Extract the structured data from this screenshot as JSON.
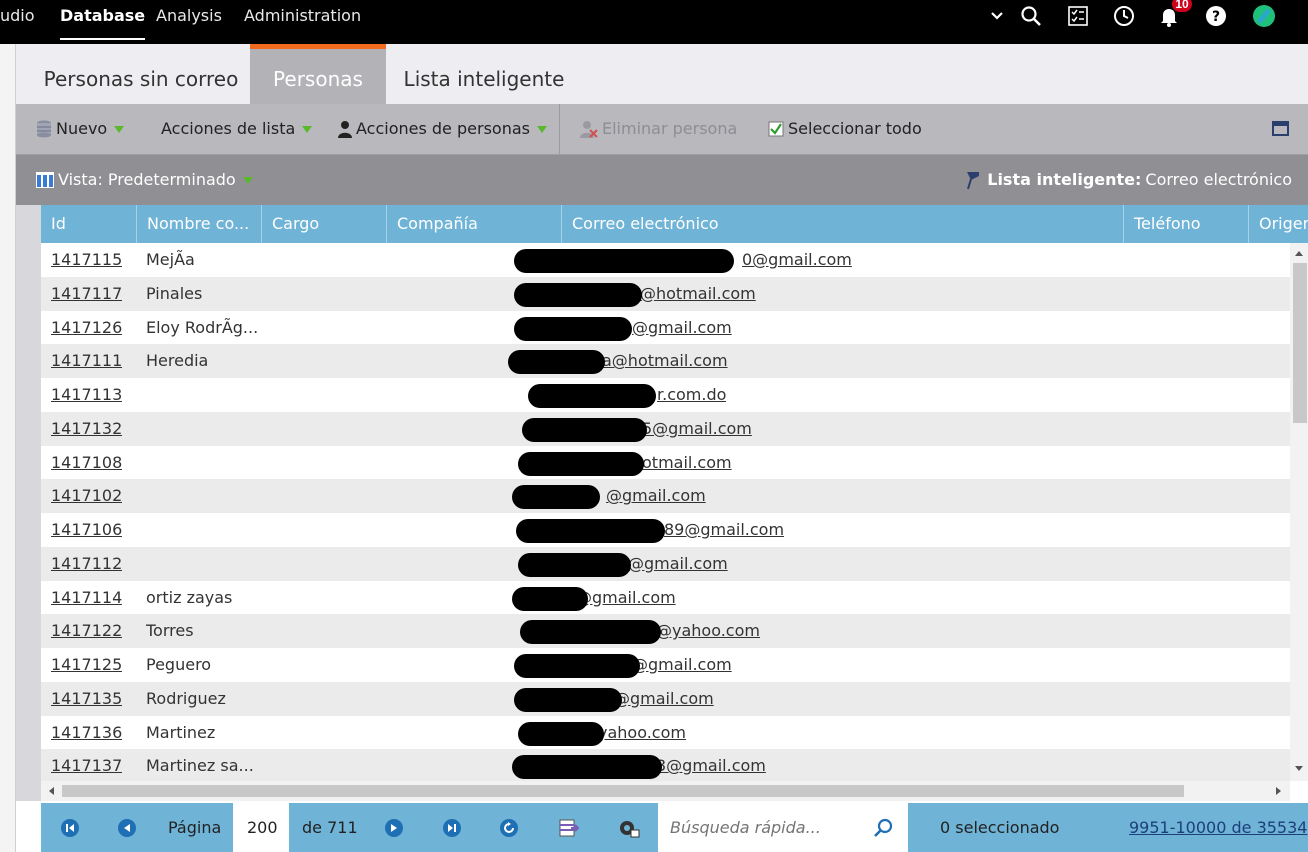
{
  "topbar": {
    "nav": [
      "udio",
      "Database",
      "Analysis",
      "Administration"
    ],
    "active_nav": "Database",
    "notification_count": "10",
    "icons": [
      "chevron-down-icon",
      "search-icon",
      "checklist-icon",
      "clock-icon",
      "bell-icon",
      "help-icon",
      "avatar-icon"
    ]
  },
  "tabs": [
    {
      "label": "Personas sin correo",
      "active": false
    },
    {
      "label": "Personas",
      "active": true
    },
    {
      "label": "Lista inteligente",
      "active": false
    }
  ],
  "toolbar": {
    "nuevo": "Nuevo",
    "acciones_lista": "Acciones de lista",
    "acciones_personas": "Acciones de personas",
    "eliminar": "Eliminar persona",
    "seleccionar": "Seleccionar todo"
  },
  "viewbar": {
    "view": "Vista: Predeterminado",
    "smartlist_label": "Lista inteligente:",
    "smartlist_value": "Correo electrónico"
  },
  "columns": [
    "Id",
    "Nombre co...",
    "Cargo",
    "Compañía",
    "Correo electrónico",
    "Teléfono",
    "Origen"
  ],
  "rows": [
    {
      "id": "1417115",
      "name": "MejÃa",
      "email": "0@gmail.com"
    },
    {
      "id": "1417117",
      "name": "Pinales",
      "email": "@hotmail.com"
    },
    {
      "id": "1417126",
      "name": "Eloy RodrÃg...",
      "email": "@gmail.com"
    },
    {
      "id": "1417111",
      "name": "Heredia",
      "email": "a@hotmail.com"
    },
    {
      "id": "1417113",
      "name": "",
      "email": "r.com.do"
    },
    {
      "id": "1417132",
      "name": "",
      "email": "5@gmail.com"
    },
    {
      "id": "1417108",
      "name": "",
      "email": "otmail.com"
    },
    {
      "id": "1417102",
      "name": "",
      "email": "@gmail.com"
    },
    {
      "id": "1417106",
      "name": "",
      "email": "89@gmail.com"
    },
    {
      "id": "1417112",
      "name": "",
      "email": "@gmail.com"
    },
    {
      "id": "1417114",
      "name": "ortiz zayas",
      "email": "@gmail.com"
    },
    {
      "id": "1417122",
      "name": "Torres",
      "email": "@yahoo.com"
    },
    {
      "id": "1417125",
      "name": "Peguero",
      "email": "@gmail.com"
    },
    {
      "id": "1417135",
      "name": "Rodriguez",
      "email": "@gmail.com"
    },
    {
      "id": "1417136",
      "name": "Martinez",
      "email": "yahoo.com"
    },
    {
      "id": "1417137",
      "name": "Martinez sa...",
      "email": "3@gmail.com"
    }
  ],
  "footer": {
    "page_label": "Página",
    "page_value": "200",
    "page_of": "de 711",
    "search_placeholder": "Búsqueda rápida...",
    "selected": "0 seleccionado",
    "range": "9951-10000 de 35534"
  }
}
